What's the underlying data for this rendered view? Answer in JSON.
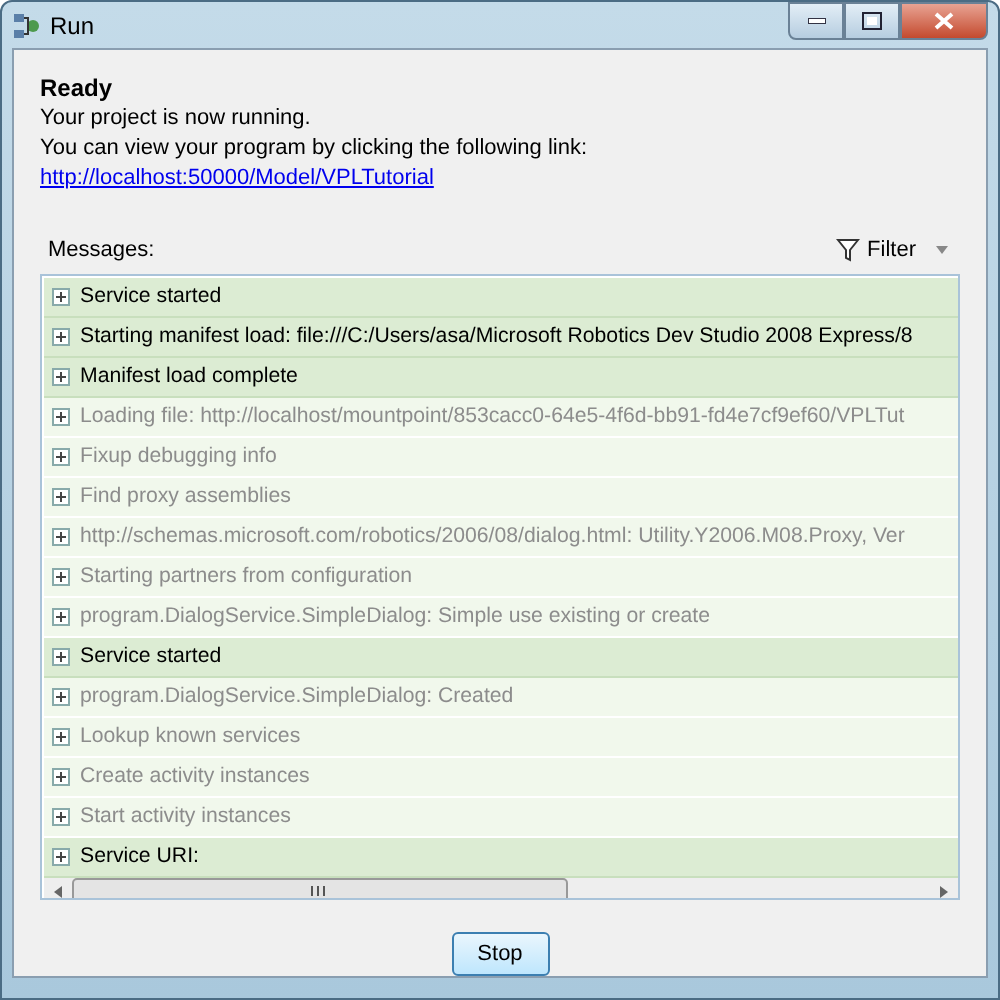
{
  "window": {
    "title": "Run"
  },
  "status": {
    "heading": "Ready",
    "line_1": "Your project is now running.",
    "line_2": "You can view your program by clicking the following link:",
    "link": "http://localhost:50000/Model/VPLTutorial"
  },
  "messages": {
    "label": "Messages:",
    "filter": "Filter",
    "rows": [
      {
        "text": "Service started",
        "emphasized": true
      },
      {
        "text": "Starting manifest load: file:///C:/Users/asa/Microsoft Robotics Dev Studio 2008 Express/8",
        "emphasized": true
      },
      {
        "text": "Manifest load complete",
        "emphasized": true
      },
      {
        "text": "Loading file: http://localhost/mountpoint/853cacc0-64e5-4f6d-bb91-fd4e7cf9ef60/VPLTut",
        "emphasized": false
      },
      {
        "text": "Fixup debugging info",
        "emphasized": false
      },
      {
        "text": "Find proxy assemblies",
        "emphasized": false
      },
      {
        "text": "http://schemas.microsoft.com/robotics/2006/08/dialog.html: Utility.Y2006.M08.Proxy, Ver",
        "emphasized": false
      },
      {
        "text": "Starting partners from configuration",
        "emphasized": false
      },
      {
        "text": "program.DialogService.SimpleDialog: Simple use existing or create",
        "emphasized": false
      },
      {
        "text": "Service started",
        "emphasized": true
      },
      {
        "text": "program.DialogService.SimpleDialog: Created",
        "emphasized": false
      },
      {
        "text": "Lookup known services",
        "emphasized": false
      },
      {
        "text": "Create activity instances",
        "emphasized": false
      },
      {
        "text": "Start activity instances",
        "emphasized": false
      },
      {
        "text": "Service URI:",
        "emphasized": true
      }
    ]
  },
  "buttons": [
    "Stop"
  ]
}
